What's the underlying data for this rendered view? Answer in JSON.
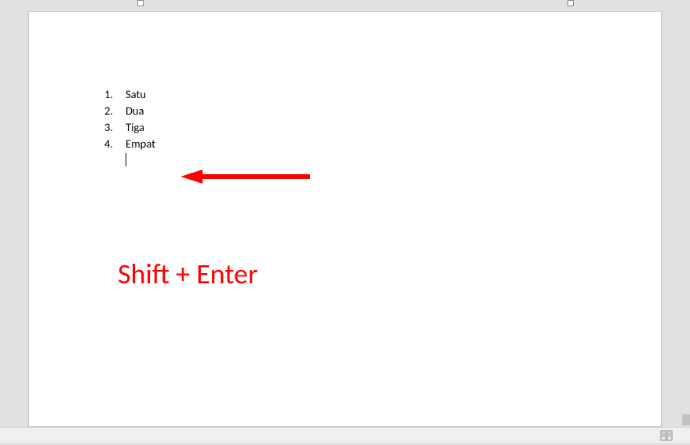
{
  "list": {
    "items": [
      {
        "number": "1.",
        "text": "Satu"
      },
      {
        "number": "2.",
        "text": "Dua"
      },
      {
        "number": "3.",
        "text": "Tiga"
      },
      {
        "number": "4.",
        "text": "Empat"
      }
    ]
  },
  "annotation": {
    "caption": "Shift + Enter"
  }
}
